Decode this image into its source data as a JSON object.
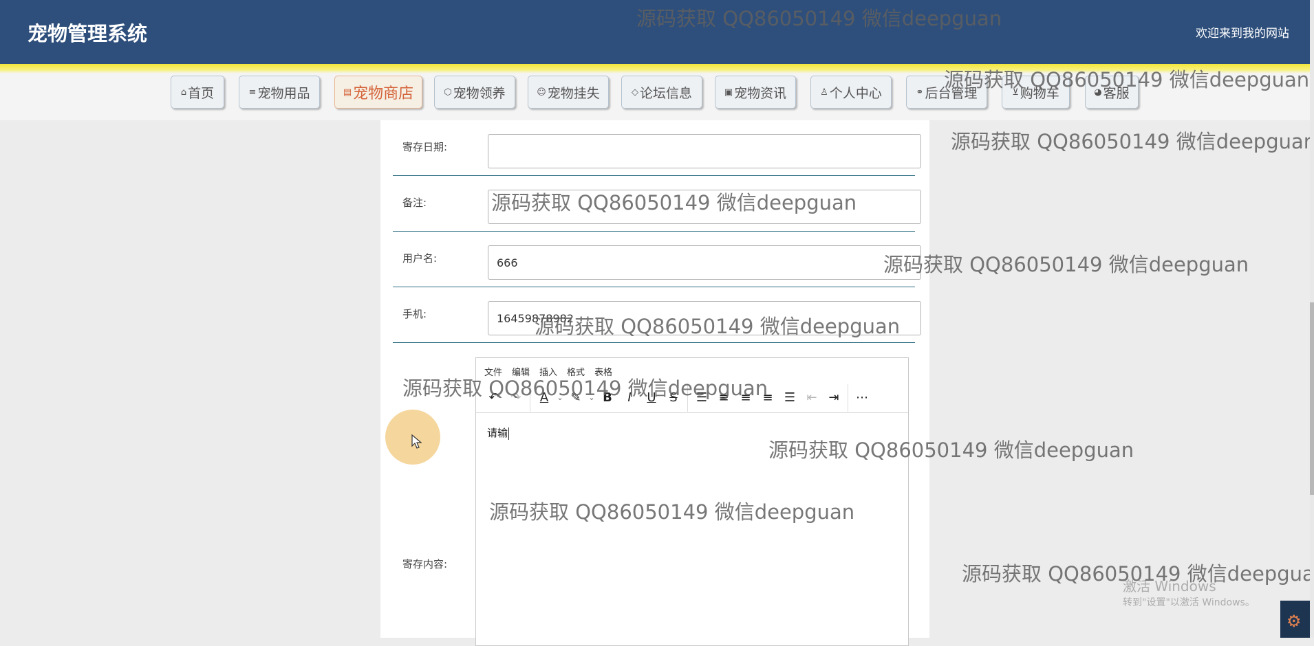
{
  "header": {
    "title": "宠物管理系统",
    "welcome": "欢迎来到我的网站"
  },
  "nav": {
    "items": [
      {
        "label": "首页",
        "icon": "⌂"
      },
      {
        "label": "宠物用品",
        "icon": "≡"
      },
      {
        "label": "宠物商店",
        "icon": "▤",
        "active": true
      },
      {
        "label": "宠物领养",
        "icon": "⬡"
      },
      {
        "label": "宠物挂失",
        "icon": "☺"
      },
      {
        "label": "论坛信息",
        "icon": "◇"
      },
      {
        "label": "宠物资讯",
        "icon": "▣"
      },
      {
        "label": "个人中心",
        "icon": "♙"
      },
      {
        "label": "后台管理",
        "icon": "⚭"
      },
      {
        "label": "购物车",
        "icon": "⊻"
      },
      {
        "label": "客服",
        "icon": "◕"
      }
    ]
  },
  "form": {
    "storage_date_label": "寄存日期:",
    "storage_date_value": "",
    "remark_label": "备注:",
    "remark_value": "",
    "username_label": "用户名:",
    "username_value": "666",
    "phone_label": "手机:",
    "phone_value": "16459878982",
    "content_label": "寄存内容:"
  },
  "editor": {
    "menu": [
      "文件",
      "编辑",
      "插入",
      "格式",
      "表格"
    ],
    "text": "请输",
    "toolbar": [
      "undo-icon",
      "redo-icon",
      "font-color-icon",
      "highlight-color-icon",
      "bold-icon",
      "italic-icon",
      "underline-icon",
      "strikethrough-icon",
      "align-justify-left-icon",
      "align-left-icon",
      "align-center-icon",
      "align-right-icon",
      "justify-icon",
      "outdent-icon",
      "indent-icon",
      "more-icon"
    ]
  },
  "watermark": "源码获取 QQ86050149 微信deepguan",
  "os_notice": {
    "title": "激活 Windows",
    "subtitle": "转到\"设置\"以激活 Windows。"
  },
  "colors": {
    "header_bg": "#2e4f7c",
    "nav_active_text": "#d4643a",
    "row_divider": "#2f6f84"
  }
}
